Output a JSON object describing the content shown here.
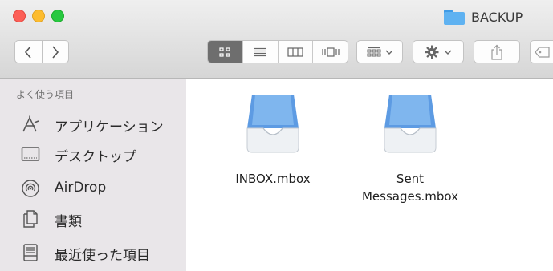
{
  "window": {
    "title": "BACKUP",
    "colors": {
      "close": "#fc5f57",
      "minimize": "#fdbc2e",
      "maximize": "#28c840",
      "folder": "#5fb2f1",
      "sidebar_bg": "#e9e6e9"
    }
  },
  "toolbar": {
    "back_icon": "chevron-left-icon",
    "forward_icon": "chevron-right-icon",
    "views": [
      "icon-view-icon",
      "list-view-icon",
      "column-view-icon",
      "coverflow-view-icon"
    ],
    "active_view": "icon-view-icon",
    "arrange_icon": "grid-arrange-icon",
    "action_icon": "gear-icon",
    "share_icon": "share-icon",
    "tags_icon": "tag-icon"
  },
  "sidebar": {
    "heading": "よく使う項目",
    "items": [
      {
        "label": "アプリケーション",
        "icon": "applications-icon"
      },
      {
        "label": "デスクトップ",
        "icon": "desktop-icon"
      },
      {
        "label": "AirDrop",
        "icon": "airdrop-icon"
      },
      {
        "label": "書類",
        "icon": "documents-icon"
      },
      {
        "label": "最近使った項目",
        "icon": "recents-icon"
      }
    ]
  },
  "files": [
    {
      "name": "INBOX.mbox",
      "icon": "mailbox-tray-icon"
    },
    {
      "name": "Sent Messages.mbox",
      "icon": "mailbox-tray-icon"
    }
  ]
}
